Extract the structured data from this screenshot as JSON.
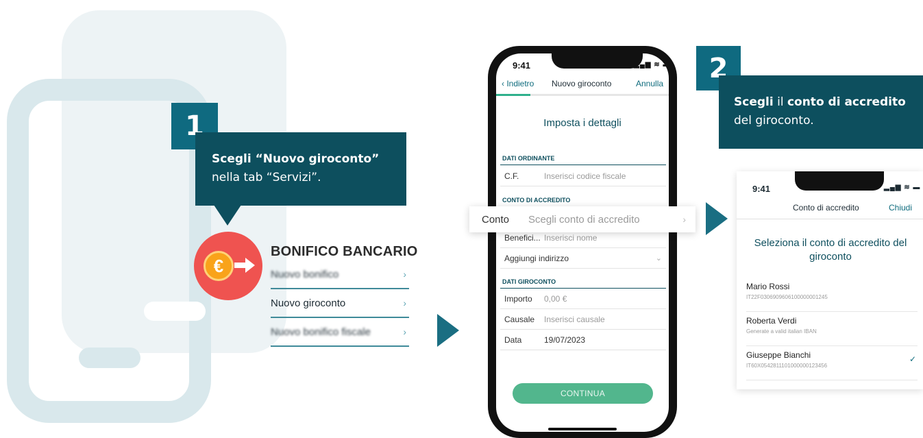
{
  "step1": {
    "number": "1",
    "callout_bold": "Scegli “Nuovo giroconto”",
    "callout_rest": "nella tab “Servizi”."
  },
  "step2": {
    "number": "2",
    "callout_bold_a": "Scegli",
    "callout_plain_a": " il ",
    "callout_bold_b": "conto di accredito",
    "callout_plain_b": "del giroconto."
  },
  "bonifico": {
    "icon": "euro-transfer-icon",
    "coin_symbol": "€",
    "title": "BONIFICO BANCARIO",
    "items": [
      {
        "label": "Nuovo bonifico",
        "blurred": true
      },
      {
        "label": "Nuovo giroconto",
        "blurred": false
      },
      {
        "label": "Nuovo bonifico fiscale",
        "blurred": true
      }
    ],
    "chevron": "›"
  },
  "phone": {
    "time": "9:41",
    "status_icons": "▂▄▆ ≋ ▬",
    "nav": {
      "back": "‹ Indietro",
      "title": "Nuovo giroconto",
      "cancel": "Annulla"
    },
    "progress": 0.2,
    "section_title": "Imposta i dettagli",
    "dati_ordinante": {
      "label": "DATI ORDINANTE",
      "cf_key": "C.F.",
      "cf_placeholder": "Inserisci codice fiscale"
    },
    "conto_accredito": {
      "label": "CONTO DI ACCREDITO",
      "conto_key": "Conto",
      "conto_placeholder": "Scegli conto di accredito",
      "beneficiario_key": "Benefici...",
      "beneficiario_placeholder": "Inserisci nome",
      "indirizzo_label": "Aggiungi indirizzo"
    },
    "dati_giroconto": {
      "label": "DATI GIROCONTO",
      "importo_key": "Importo",
      "importo_value": "0,00 €",
      "causale_key": "Causale",
      "causale_placeholder": "Inserisci causale",
      "data_key": "Data",
      "data_value": "19/07/2023"
    },
    "continue_button": "CONTINUA"
  },
  "panel": {
    "time": "9:41",
    "status_icons": "▂▄▆ ≋ ▬",
    "title": "Conto di accredito",
    "close": "Chiudi",
    "heading": "Seleziona il conto di accredito del giroconto",
    "accounts": [
      {
        "name": "Mario Rossi",
        "iban": "IT22F0306909606100000001245",
        "selected": false
      },
      {
        "name": "Roberta Verdi",
        "iban": "Generate a valid italian IBAN",
        "selected": false
      },
      {
        "name": "Giuseppe Bianchi",
        "iban": "IT60X0542811101000000123456",
        "selected": true
      }
    ],
    "check_glyph": "✓"
  },
  "colors": {
    "accent_teal": "#0f6a80",
    "callout_dark": "#0d4f5e",
    "button_green": "#52b68d",
    "bonifico_red": "#ef5350",
    "coin_orange": "#f9a31a"
  }
}
